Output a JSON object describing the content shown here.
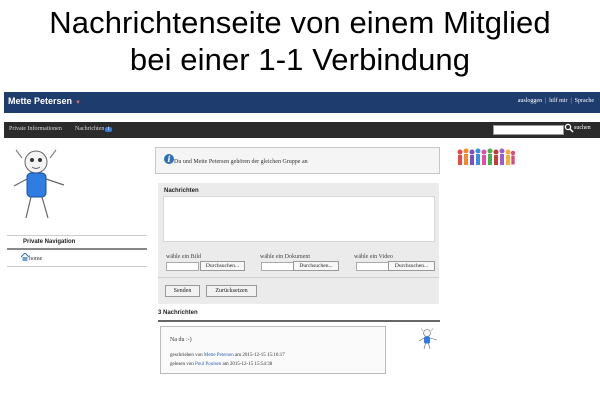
{
  "slide": {
    "title_line1": "Nachrichtenseite von einem Mitglied",
    "title_line2": "bei einer 1-1 Verbindung"
  },
  "header": {
    "brand": "Mette Petersen",
    "links": [
      "ausloggen",
      "hilf mir",
      "Sprache"
    ]
  },
  "nav": {
    "items": [
      "Private Informationen",
      "Nachrichten"
    ],
    "badge": "1",
    "search_value": "",
    "search_button": "suchen"
  },
  "sidebar": {
    "title": "Private Navigation",
    "home": "home"
  },
  "info": {
    "text": "Du und Mette Petersen gehören der gleichen Gruppe an"
  },
  "compose": {
    "title": "Nachrichten",
    "textarea_value": "",
    "uploads": [
      {
        "label": "wähle ein Bild",
        "button": "Durchsuchen..."
      },
      {
        "label": "wähle ein Dokument",
        "button": "Durchsuchen..."
      },
      {
        "label": "wähle ein Video",
        "button": "Durchsuchen..."
      }
    ],
    "send_button": "Senden",
    "reset_button": "Zurücksetzen"
  },
  "thread": {
    "title": "3 Nachrichten",
    "message": {
      "text": "Na du :-)",
      "sent_prefix": "geschrieben von",
      "sent_by": "Mette Petersen",
      "sent_mid": "am",
      "sent_time": "2015-12-15 15:16:17",
      "read_prefix": "gelesen von",
      "read_by": "Poul Poulsen",
      "read_mid": "am",
      "read_time": "2015-12-15 15:54:38"
    }
  },
  "colors": {
    "topbar": "#1f3c6f",
    "navbar": "#2b2b2b",
    "link": "#2a5db0",
    "accent": "#3a7bd5"
  }
}
